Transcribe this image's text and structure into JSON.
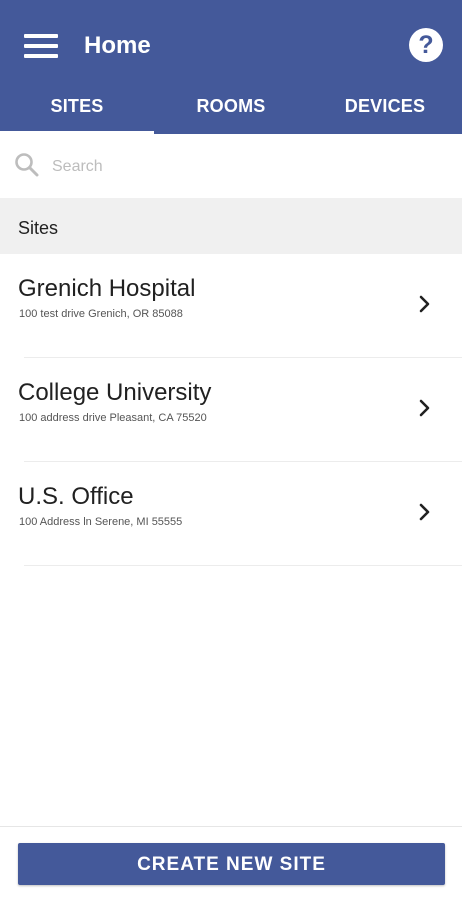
{
  "header": {
    "title": "Home",
    "help_icon_text": "?"
  },
  "tabs": [
    {
      "label": "SITES",
      "active": true
    },
    {
      "label": "ROOMS",
      "active": false
    },
    {
      "label": "DEVICES",
      "active": false
    }
  ],
  "search": {
    "placeholder": "Search",
    "value": ""
  },
  "section": {
    "title": "Sites"
  },
  "sites": [
    {
      "name": "Grenich Hospital",
      "address": "100 test drive Grenich, OR 85088"
    },
    {
      "name": "College University",
      "address": "100 address drive Pleasant, CA 75520"
    },
    {
      "name": "U.S. Office",
      "address": "100 Address ln Serene, MI 55555"
    }
  ],
  "footer": {
    "create_label": "CREATE NEW SITE"
  },
  "colors": {
    "primary": "#44599a",
    "section_bg": "#f0f0f0"
  },
  "icons": {
    "menu": "hamburger-menu-icon",
    "help": "help-icon",
    "search": "search-icon",
    "chevron": "chevron-right-icon"
  }
}
